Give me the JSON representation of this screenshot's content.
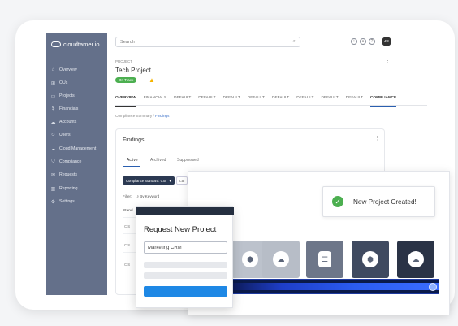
{
  "app": {
    "brand": "cloudtamer.io"
  },
  "sidebar": {
    "items": [
      {
        "label": "Overview",
        "icon": "home-icon"
      },
      {
        "label": "OUs",
        "icon": "org-icon"
      },
      {
        "label": "Projects",
        "icon": "folder-icon"
      },
      {
        "label": "Financials",
        "icon": "dollar-icon"
      },
      {
        "label": "Accounts",
        "icon": "cloud-icon"
      },
      {
        "label": "Users",
        "icon": "users-icon"
      },
      {
        "label": "Cloud Management",
        "icon": "cloud-gear-icon"
      },
      {
        "label": "Compliance",
        "icon": "shield-icon"
      },
      {
        "label": "Requests",
        "icon": "request-icon"
      },
      {
        "label": "Reporting",
        "icon": "chart-icon"
      },
      {
        "label": "Settings",
        "icon": "gear-icon"
      }
    ]
  },
  "topbar": {
    "search_placeholder": "Search",
    "avatar_initials": "JD"
  },
  "project": {
    "label": "PROJECT",
    "title": "Tech Project",
    "status": "On Track",
    "tabs": [
      "OVERVIEW",
      "FINANCIALS",
      "DEFAULT",
      "DEFAULT",
      "DEFAULT",
      "DEFAULT",
      "DEFAULT",
      "DEFAULT",
      "DEFAULT",
      "DEFAULT",
      "COMPLIANCE"
    ]
  },
  "breadcrumb": {
    "prefix": "Compliance Summary / ",
    "current": "Findings"
  },
  "findings": {
    "title": "Findings",
    "tabs": [
      "Active",
      "Archived",
      "Suppressed"
    ],
    "filter_button": "Compliance Standard: CIS",
    "filter_button2": "Cat",
    "filter_label": "Filter:",
    "filter_keyword": "By Keyword",
    "column_header": "Stand",
    "row_ids": [
      "CIS",
      "CIS",
      "CIS"
    ]
  },
  "toast": {
    "message": "New Project Created!"
  },
  "request_modal": {
    "title": "Request New Project",
    "input_value": "Marketing CRM"
  },
  "progress": {
    "value": 1.0
  },
  "colors": {
    "sidebar": "#64708a",
    "success": "#4caf50",
    "primary": "#1e88e5",
    "warning": "#f5b400"
  }
}
